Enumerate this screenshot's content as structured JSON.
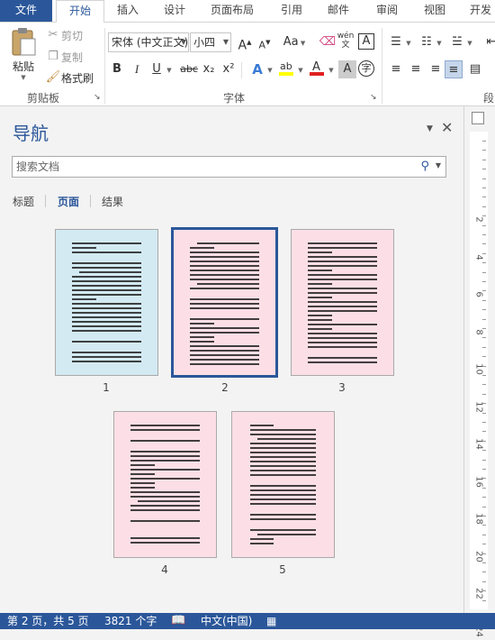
{
  "tabs": {
    "file": "文件",
    "home": "开始",
    "insert": "插入",
    "design": "设计",
    "layout": "页面布局",
    "references": "引用",
    "mailings": "邮件",
    "review": "审阅",
    "view": "视图",
    "developer": "开发"
  },
  "clipboard": {
    "paste": "粘贴",
    "cut": "剪切",
    "copy": "复制",
    "format_painter": "格式刷",
    "group_label": "剪贴板"
  },
  "font": {
    "name": "宋体 (中文正文)",
    "size": "小四",
    "grow_icon": "A",
    "shrink_icon": "A",
    "change_case": "Aa",
    "phonetic": "wén",
    "bold": "B",
    "italic": "I",
    "underline": "U",
    "strike": "abc",
    "subscript": "x₂",
    "superscript": "x²",
    "group_label": "字体"
  },
  "paragraph": {
    "group_label": "段"
  },
  "nav": {
    "title": "导航",
    "search_placeholder": "搜索文档",
    "tab_headings": "标题",
    "tab_pages": "页面",
    "tab_results": "结果",
    "pages": [
      "1",
      "2",
      "3",
      "4",
      "5"
    ],
    "selected_page": "2"
  },
  "ruler": {
    "numbers": [
      "2",
      "4",
      "6",
      "8",
      "10",
      "12",
      "14",
      "16",
      "18",
      "20",
      "22",
      "24"
    ]
  },
  "status": {
    "page": "第 2 页，共 5 页",
    "words": "3821 个字",
    "language": "中文(中国)"
  },
  "colors": {
    "accent": "#2b579a",
    "thumb_blue": "#d3eaf2",
    "thumb_pink": "#fcdfe6"
  }
}
